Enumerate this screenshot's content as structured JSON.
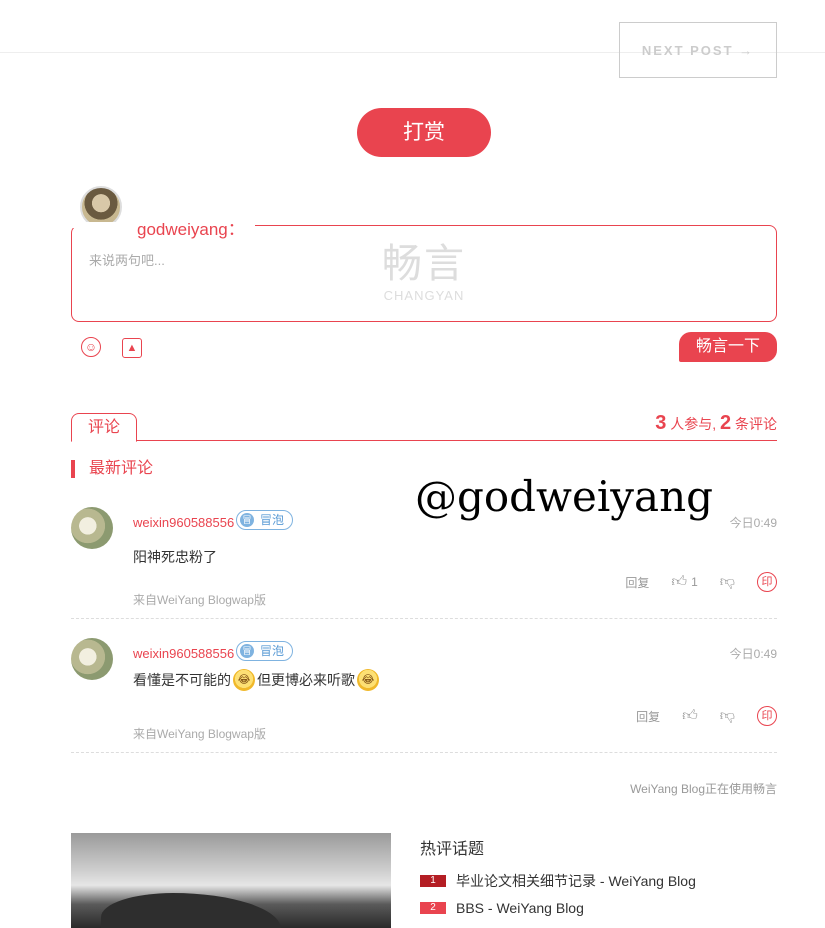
{
  "nav": {
    "next_post": "NEXT POST →"
  },
  "reward": {
    "label": "打赏"
  },
  "composer": {
    "username": "godweiyang：",
    "placeholder": "来说两句吧...",
    "watermark_cn": "畅言",
    "watermark_en": "CHANGYAN",
    "emoji_icon": "smile-icon",
    "image_icon": "image-icon",
    "submit_label": "畅言一下"
  },
  "tabs": {
    "comments_label": "评论"
  },
  "stats": {
    "participants": "3",
    "participants_label": "人参与,",
    "comments": "2",
    "comments_label": "条评论"
  },
  "section": {
    "latest_title": "最新评论"
  },
  "overlay_handle": "@godweiyang",
  "comments": [
    {
      "user": "weixin960588556",
      "badge": "冒泡",
      "badge_icon": "冒",
      "time": "今日0:49",
      "text_parts": [
        "阳神死忠粉了"
      ],
      "reply_label": "回复",
      "like_count": "1",
      "source": "来自WeiYang Blogwap版"
    },
    {
      "user": "weixin960588556",
      "badge": "冒泡",
      "badge_icon": "冒",
      "time": "今日0:49",
      "text_parts": [
        "看懂是不可能的",
        "但更博必来听歌"
      ],
      "reply_label": "回复",
      "like_count": "",
      "source": "来自WeiYang Blogwap版"
    }
  ],
  "powered_by": "WeiYang Blog正在使用畅言",
  "hot_topics": {
    "title": "热评话题",
    "items": [
      {
        "rank": "1",
        "title": "毕业论文相关细节记录 - WeiYang Blog"
      },
      {
        "rank": "2",
        "title": "BBS - WeiYang Blog"
      }
    ]
  },
  "colors": {
    "accent": "#e9444f",
    "badge_blue": "#7fb3e0",
    "muted": "#aaaaaa"
  }
}
